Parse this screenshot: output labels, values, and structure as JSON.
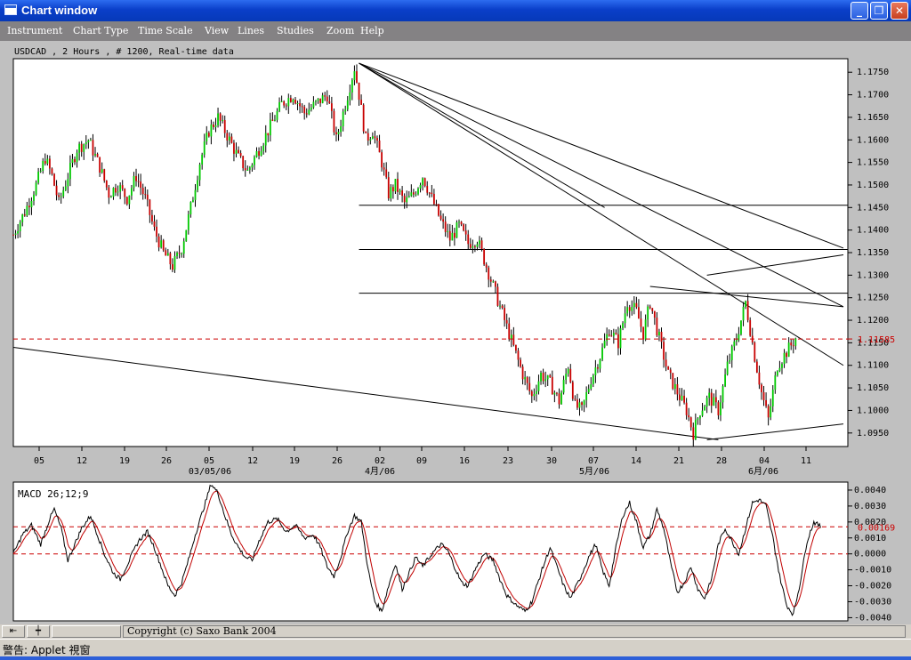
{
  "window": {
    "title": "Chart window"
  },
  "menu": [
    "Instrument",
    "Chart Type",
    "Time Scale",
    "View",
    "Lines",
    "Studies",
    "Zoom",
    "Help"
  ],
  "chart_data": [
    {
      "type": "candlestick",
      "title": "USDCAD , 2 Hours , # 1200, Real-time data",
      "ylim": [
        1.092,
        1.178
      ],
      "y_ticks": [
        "1.1750",
        "1.1700",
        "1.1650",
        "1.1600",
        "1.1550",
        "1.1500",
        "1.1450",
        "1.1400",
        "1.1350",
        "1.1300",
        "1.1250",
        "1.1200",
        "1.1150",
        "1.1100",
        "1.1050",
        "1.1000",
        "1.0950"
      ],
      "current_price": "1.11585",
      "x_ticks": [
        "05",
        "12",
        "19",
        "26",
        "05",
        "12",
        "19",
        "26",
        "02",
        "09",
        "16",
        "23",
        "30",
        "07",
        "14",
        "21",
        "28",
        "04",
        "11"
      ],
      "x_month_labels": [
        "03/05/06",
        "4月/06",
        "5月/06",
        "6月/06"
      ],
      "price_path": [
        [
          0,
          1.139
        ],
        [
          5,
          1.144
        ],
        [
          10,
          1.15
        ],
        [
          14,
          1.156
        ],
        [
          17,
          1.152
        ],
        [
          20,
          1.146
        ],
        [
          24,
          1.152
        ],
        [
          28,
          1.158
        ],
        [
          33,
          1.16
        ],
        [
          38,
          1.154
        ],
        [
          42,
          1.148
        ],
        [
          46,
          1.15
        ],
        [
          50,
          1.147
        ],
        [
          54,
          1.152
        ],
        [
          58,
          1.147
        ],
        [
          62,
          1.14
        ],
        [
          66,
          1.135
        ],
        [
          70,
          1.132
        ],
        [
          74,
          1.136
        ],
        [
          78,
          1.145
        ],
        [
          82,
          1.155
        ],
        [
          86,
          1.162
        ],
        [
          90,
          1.165
        ],
        [
          95,
          1.16
        ],
        [
          99,
          1.156
        ],
        [
          103,
          1.153
        ],
        [
          108,
          1.158
        ],
        [
          113,
          1.163
        ],
        [
          118,
          1.168
        ],
        [
          123,
          1.17
        ],
        [
          128,
          1.166
        ],
        [
          133,
          1.168
        ],
        [
          138,
          1.17
        ],
        [
          142,
          1.16
        ],
        [
          146,
          1.168
        ],
        [
          150,
          1.176
        ],
        [
          152,
          1.17
        ],
        [
          155,
          1.16
        ],
        [
          158,
          1.162
        ],
        [
          162,
          1.155
        ],
        [
          165,
          1.148
        ],
        [
          168,
          1.15
        ],
        [
          172,
          1.146
        ],
        [
          176,
          1.148
        ],
        [
          180,
          1.152
        ],
        [
          184,
          1.147
        ],
        [
          188,
          1.142
        ],
        [
          192,
          1.138
        ],
        [
          196,
          1.141
        ],
        [
          200,
          1.137
        ],
        [
          204,
          1.138
        ],
        [
          208,
          1.132
        ],
        [
          212,
          1.126
        ],
        [
          216,
          1.12
        ],
        [
          220,
          1.114
        ],
        [
          224,
          1.108
        ],
        [
          228,
          1.103
        ],
        [
          232,
          1.108
        ],
        [
          236,
          1.106
        ],
        [
          240,
          1.102
        ],
        [
          244,
          1.11
        ],
        [
          247,
          1.101
        ],
        [
          250,
          1.1
        ],
        [
          254,
          1.107
        ],
        [
          258,
          1.112
        ],
        [
          262,
          1.118
        ],
        [
          266,
          1.115
        ],
        [
          270,
          1.124
        ],
        [
          274,
          1.122
        ],
        [
          277,
          1.117
        ],
        [
          280,
          1.124
        ],
        [
          284,
          1.116
        ],
        [
          288,
          1.108
        ],
        [
          292,
          1.104
        ],
        [
          296,
          1.1
        ],
        [
          299,
          1.095
        ],
        [
          302,
          1.1
        ],
        [
          306,
          1.103
        ],
        [
          310,
          1.1
        ],
        [
          314,
          1.11
        ],
        [
          318,
          1.116
        ],
        [
          322,
          1.124
        ],
        [
          326,
          1.112
        ],
        [
          329,
          1.104
        ],
        [
          332,
          1.098
        ],
        [
          336,
          1.11
        ],
        [
          340,
          1.113
        ],
        [
          344,
          1.116
        ]
      ],
      "trend_lines": [
        {
          "from": [
            152,
            1.177
          ],
          "to": [
            365,
            1.136
          ]
        },
        {
          "from": [
            152,
            1.177
          ],
          "to": [
            365,
            1.123
          ]
        },
        {
          "from": [
            152,
            1.177
          ],
          "to": [
            365,
            1.11
          ]
        },
        {
          "from": [
            152,
            1.177
          ],
          "to": [
            260,
            1.145
          ]
        },
        {
          "from": [
            0,
            1.114
          ],
          "to": [
            310,
            1.0935
          ]
        },
        {
          "from": [
            305,
            1.0935
          ],
          "to": [
            365,
            1.097
          ]
        },
        {
          "from": [
            280,
            1.1275
          ],
          "to": [
            365,
            1.123
          ]
        },
        {
          "from": [
            305,
            1.13
          ],
          "to": [
            365,
            1.1345
          ]
        }
      ],
      "horizontal_lines": [
        1.1455,
        1.1357,
        1.126
      ]
    },
    {
      "type": "line",
      "title": "MACD 26;12;9",
      "ylim": [
        -0.0042,
        0.0045
      ],
      "y_ticks": [
        "0.0040",
        "0.0030",
        "0.0020",
        "0.0010",
        "0.0000",
        "-0.0010",
        "-0.0020",
        "-0.0030",
        "-0.0040"
      ],
      "current_value": "0.00169",
      "macd_path": [
        [
          0,
          0.0
        ],
        [
          4,
          0.0012
        ],
        [
          8,
          0.0018
        ],
        [
          12,
          0.0006
        ],
        [
          16,
          0.0022
        ],
        [
          18,
          0.0028
        ],
        [
          21,
          0.0016
        ],
        [
          24,
          -0.0004
        ],
        [
          27,
          0.0006
        ],
        [
          30,
          0.0016
        ],
        [
          34,
          0.0024
        ],
        [
          37,
          0.0012
        ],
        [
          40,
          0.0
        ],
        [
          44,
          -0.0012
        ],
        [
          47,
          -0.0016
        ],
        [
          51,
          -0.0004
        ],
        [
          55,
          0.0008
        ],
        [
          59,
          0.0014
        ],
        [
          62,
          0.0004
        ],
        [
          65,
          -0.0008
        ],
        [
          68,
          -0.002
        ],
        [
          71,
          -0.0026
        ],
        [
          74,
          -0.0018
        ],
        [
          77,
          -0.0004
        ],
        [
          80,
          0.0012
        ],
        [
          84,
          0.003
        ],
        [
          87,
          0.0044
        ],
        [
          90,
          0.0038
        ],
        [
          93,
          0.0024
        ],
        [
          96,
          0.0012
        ],
        [
          99,
          0.0004
        ],
        [
          102,
          -0.0002
        ],
        [
          105,
          -0.0004
        ],
        [
          108,
          0.0008
        ],
        [
          112,
          0.002
        ],
        [
          116,
          0.0022
        ],
        [
          120,
          0.0014
        ],
        [
          124,
          0.0018
        ],
        [
          128,
          0.001
        ],
        [
          132,
          0.0012
        ],
        [
          135,
          0.0004
        ],
        [
          138,
          -0.0008
        ],
        [
          141,
          -0.0014
        ],
        [
          144,
          -0.0002
        ],
        [
          147,
          0.0014
        ],
        [
          150,
          0.0024
        ],
        [
          153,
          0.002
        ],
        [
          156,
          -0.001
        ],
        [
          159,
          -0.003
        ],
        [
          162,
          -0.0036
        ],
        [
          165,
          -0.002
        ],
        [
          168,
          -0.0006
        ],
        [
          171,
          -0.0022
        ],
        [
          174,
          -0.0012
        ],
        [
          177,
          -0.0002
        ],
        [
          180,
          -0.0008
        ],
        [
          184,
          0.0
        ],
        [
          188,
          0.0006
        ],
        [
          191,
          0.0002
        ],
        [
          194,
          -0.0008
        ],
        [
          197,
          -0.0018
        ],
        [
          200,
          -0.002
        ],
        [
          203,
          -0.001
        ],
        [
          207,
          0.0
        ],
        [
          211,
          -0.0004
        ],
        [
          214,
          -0.0016
        ],
        [
          217,
          -0.0026
        ],
        [
          221,
          -0.0032
        ],
        [
          225,
          -0.0036
        ],
        [
          228,
          -0.003
        ],
        [
          232,
          -0.0012
        ],
        [
          236,
          0.0004
        ],
        [
          239,
          -0.0008
        ],
        [
          242,
          -0.002
        ],
        [
          245,
          -0.0028
        ],
        [
          249,
          -0.0016
        ],
        [
          253,
          -0.0002
        ],
        [
          256,
          0.0006
        ],
        [
          259,
          -0.001
        ],
        [
          262,
          -0.002
        ],
        [
          265,
          0.0004
        ],
        [
          268,
          0.0024
        ],
        [
          271,
          0.0032
        ],
        [
          274,
          0.002
        ],
        [
          277,
          0.0004
        ],
        [
          280,
          0.0012
        ],
        [
          283,
          0.0028
        ],
        [
          286,
          0.0016
        ],
        [
          289,
          -0.0006
        ],
        [
          292,
          -0.0024
        ],
        [
          295,
          -0.0018
        ],
        [
          298,
          -0.0008
        ],
        [
          301,
          -0.0022
        ],
        [
          304,
          -0.0028
        ],
        [
          307,
          -0.0016
        ],
        [
          310,
          0.0006
        ],
        [
          313,
          0.0016
        ],
        [
          316,
          0.0008
        ],
        [
          319,
          0.0
        ],
        [
          322,
          0.0016
        ],
        [
          325,
          0.0032
        ],
        [
          328,
          0.0034
        ],
        [
          331,
          0.003
        ],
        [
          334,
          0.001
        ],
        [
          337,
          -0.0014
        ],
        [
          340,
          -0.0032
        ],
        [
          343,
          -0.0038
        ],
        [
          346,
          -0.0018
        ],
        [
          349,
          0.0008
        ],
        [
          352,
          0.002
        ],
        [
          355,
          0.0017
        ]
      ],
      "levels": [
        0.0017,
        0.0
      ]
    }
  ],
  "bottom": {
    "copyright": "Copyright (c) Saxo Bank 2004"
  },
  "status": {
    "text": "警告: Applet 視窗"
  },
  "colors": {
    "up": "#00c800",
    "down": "#c80000",
    "signal": "#c00000",
    "guide": "#cc0000"
  }
}
